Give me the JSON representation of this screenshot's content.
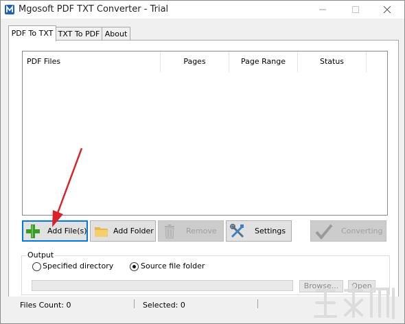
{
  "window": {
    "title": "Mgosoft PDF TXT Converter - Trial"
  },
  "tabs": [
    {
      "label": "PDF To TXT"
    },
    {
      "label": "TXT To PDF"
    },
    {
      "label": "About"
    }
  ],
  "file_list": {
    "columns": [
      "PDF Files",
      "Pages",
      "Page Range",
      "Status"
    ],
    "rows": []
  },
  "buttons": {
    "add_files": {
      "label": "Add File(s)",
      "icon": "plus-icon"
    },
    "add_folder": {
      "label": "Add Folder",
      "icon": "folder-icon"
    },
    "remove": {
      "label": "Remove",
      "icon": "trash-icon"
    },
    "settings": {
      "label": "Settings",
      "icon": "tools-icon"
    },
    "converting": {
      "label": "Converting",
      "icon": "checkmark-icon"
    }
  },
  "output": {
    "group_label": "Output",
    "options": [
      {
        "label": "Specified directory",
        "checked": false
      },
      {
        "label": "Source file folder",
        "checked": true
      }
    ],
    "directory_value": "",
    "browse_label": "Browse...",
    "open_label": "Open"
  },
  "status": {
    "files_count": "Files Count: 0",
    "selected": "Selected: 0"
  },
  "colors": {
    "focus_blue": "#0078d7",
    "arrow_red": "#d9232a",
    "plus_green": "#3a9a2a"
  }
}
